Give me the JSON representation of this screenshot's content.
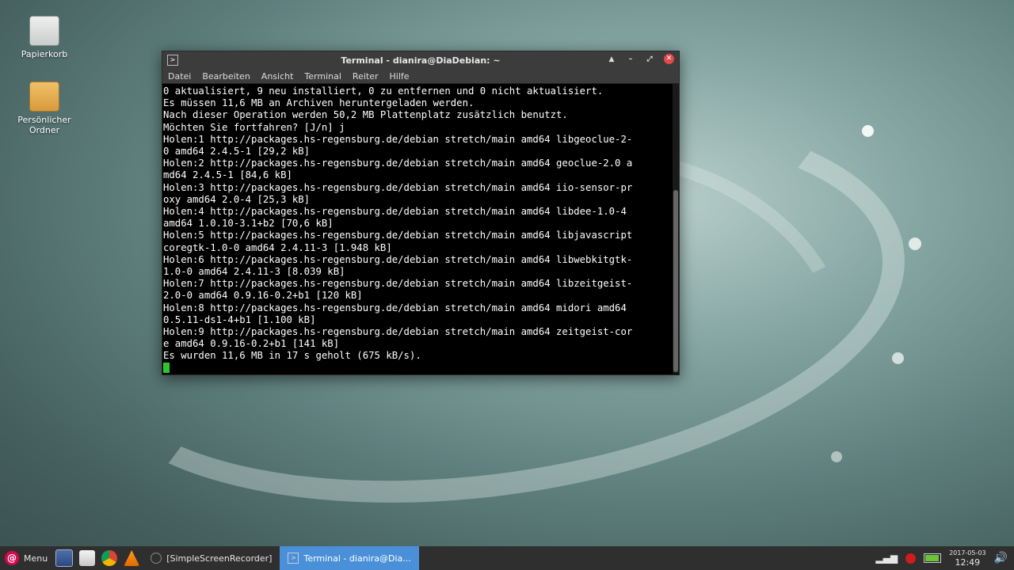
{
  "desktop": {
    "icons": [
      {
        "label": "Papierkorb"
      },
      {
        "label": "Persönlicher Ordner"
      }
    ]
  },
  "window": {
    "title": "Terminal - dianira@DiaDebian: ~",
    "menu": [
      "Datei",
      "Bearbeiten",
      "Ansicht",
      "Terminal",
      "Reiter",
      "Hilfe"
    ],
    "lines": [
      "0 aktualisiert, 9 neu installiert, 0 zu entfernen und 0 nicht aktualisiert.",
      "Es müssen 11,6 MB an Archiven heruntergeladen werden.",
      "Nach dieser Operation werden 50,2 MB Plattenplatz zusätzlich benutzt.",
      "Möchten Sie fortfahren? [J/n] j",
      "Holen:1 http://packages.hs-regensburg.de/debian stretch/main amd64 libgeoclue-2-",
      "0 amd64 2.4.5-1 [29,2 kB]",
      "Holen:2 http://packages.hs-regensburg.de/debian stretch/main amd64 geoclue-2.0 a",
      "md64 2.4.5-1 [84,6 kB]",
      "Holen:3 http://packages.hs-regensburg.de/debian stretch/main amd64 iio-sensor-pr",
      "oxy amd64 2.0-4 [25,3 kB]",
      "Holen:4 http://packages.hs-regensburg.de/debian stretch/main amd64 libdee-1.0-4",
      "amd64 1.0.10-3.1+b2 [70,6 kB]",
      "Holen:5 http://packages.hs-regensburg.de/debian stretch/main amd64 libjavascript",
      "coregtk-1.0-0 amd64 2.4.11-3 [1.948 kB]",
      "Holen:6 http://packages.hs-regensburg.de/debian stretch/main amd64 libwebkitgtk-",
      "1.0-0 amd64 2.4.11-3 [8.039 kB]",
      "Holen:7 http://packages.hs-regensburg.de/debian stretch/main amd64 libzeitgeist-",
      "2.0-0 amd64 0.9.16-0.2+b1 [120 kB]",
      "Holen:8 http://packages.hs-regensburg.de/debian stretch/main amd64 midori amd64",
      "0.5.11-ds1-4+b1 [1.100 kB]",
      "Holen:9 http://packages.hs-regensburg.de/debian stretch/main amd64 zeitgeist-cor",
      "e amd64 0.9.16-0.2+b1 [141 kB]",
      "Es wurden 11,6 MB in 17 s geholt (675 kB/s)."
    ]
  },
  "taskbar": {
    "menu_label": "Menu",
    "tasks": [
      {
        "label": "[SimpleScreenRecorder]"
      },
      {
        "label": "Terminal - dianira@Dia..."
      }
    ],
    "date": "2017-05-03",
    "time": "12:49"
  },
  "colors": {
    "accent": "#4a90d9",
    "cursor": "#2ec82e",
    "close": "#e14a4a"
  }
}
